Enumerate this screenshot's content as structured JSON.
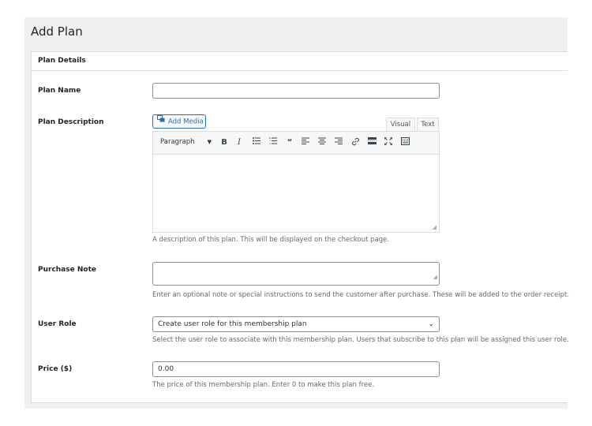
{
  "page_title": "Add Plan",
  "card_title": "Plan Details",
  "fields": {
    "plan_name": {
      "label": "Plan Name",
      "value": ""
    },
    "plan_description": {
      "label": "Plan Description",
      "add_media": "Add Media",
      "tab_visual": "Visual",
      "tab_text": "Text",
      "format_select": "Paragraph",
      "description": "A description of this plan. This will be displayed on the checkout page."
    },
    "purchase_note": {
      "label": "Purchase Note",
      "description": "Enter an optional note or special instructions to send the customer after purchase. These will be added to the order receipt."
    },
    "user_role": {
      "label": "User Role",
      "selected": "Create user role for this membership plan",
      "description": "Select the user role to associate with this membership plan. Users that subscribe to this plan will be assigned this user role."
    },
    "price": {
      "label": "Price ($)",
      "value": "0.00",
      "description": "The price of this membership plan. Enter 0 to make this plan free."
    }
  },
  "toolbar_icons": [
    "bold-icon",
    "italic-icon",
    "bulleted-list-icon",
    "numbered-list-icon",
    "blockquote-icon",
    "align-left-icon",
    "align-center-icon",
    "align-right-icon",
    "link-icon",
    "read-more-icon",
    "fullscreen-icon",
    "toolbar-toggle-icon"
  ]
}
